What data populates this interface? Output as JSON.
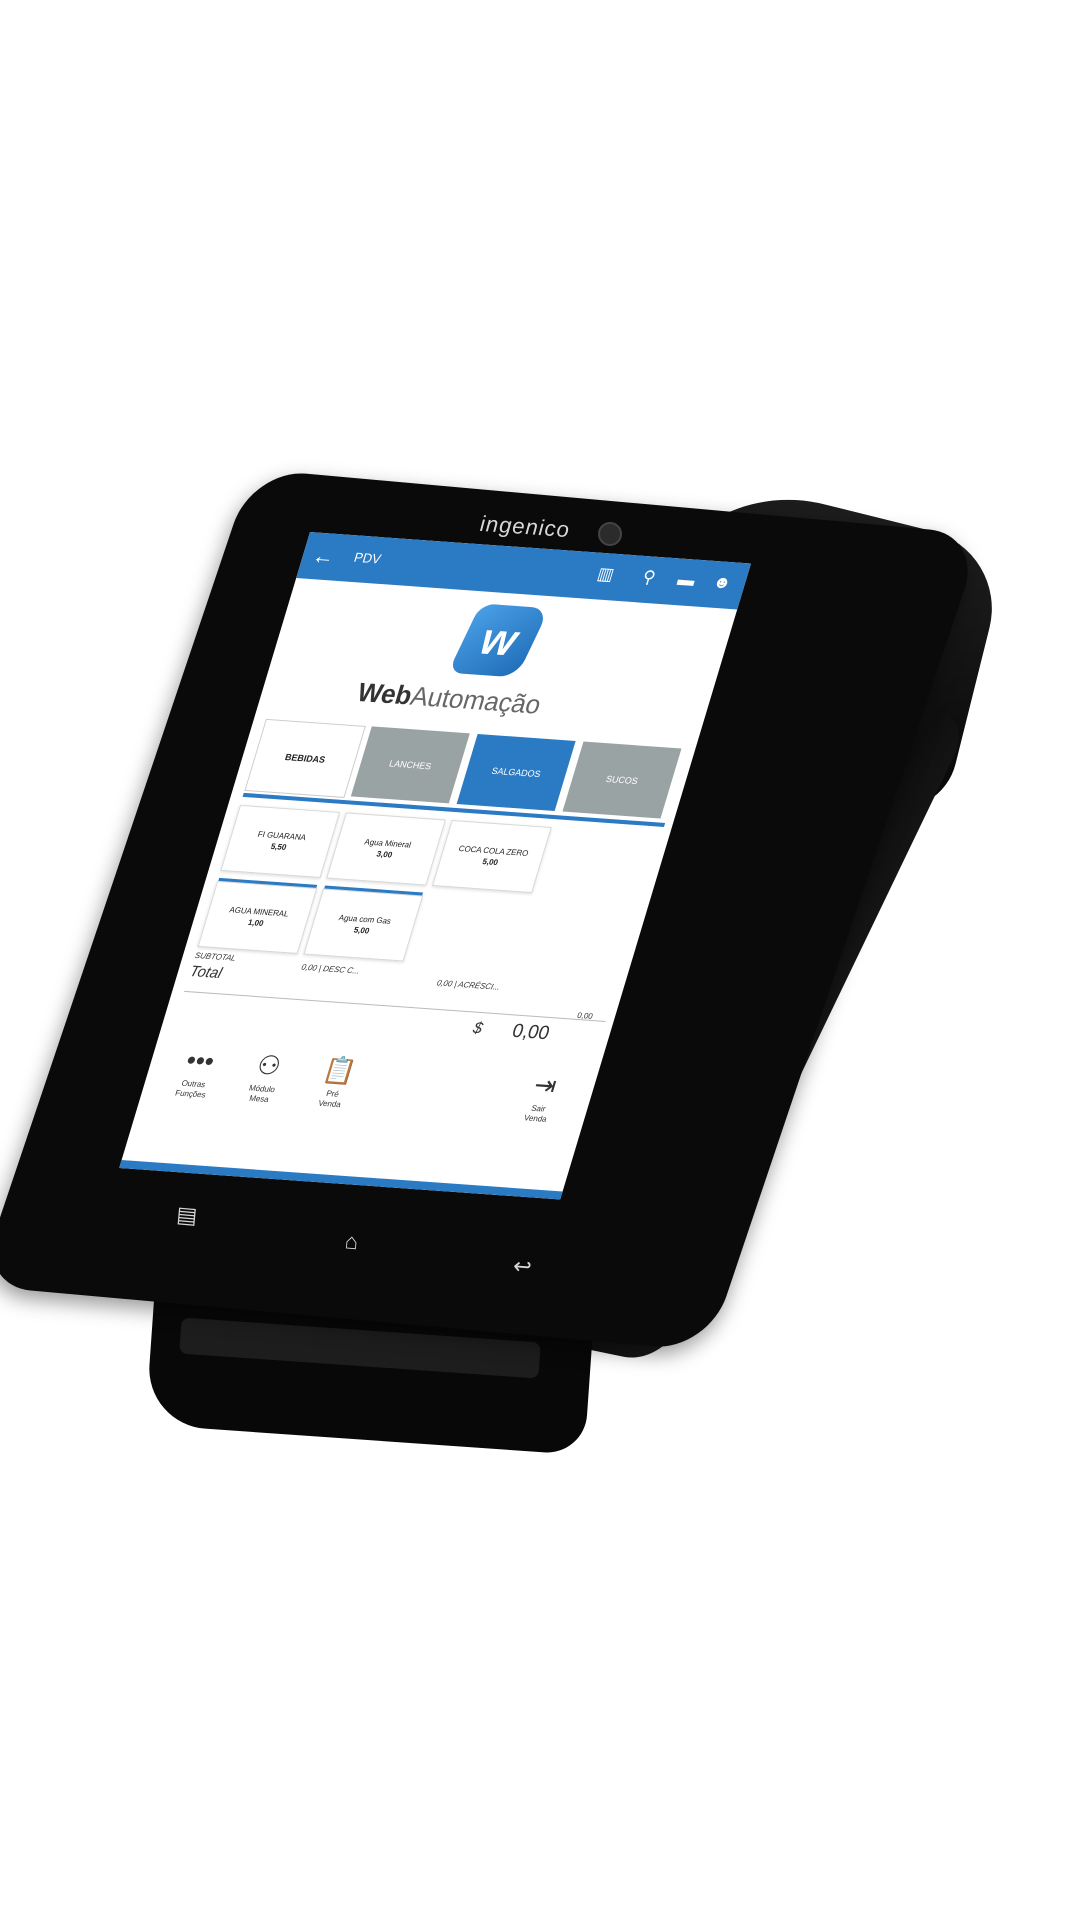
{
  "device": {
    "brand": "ingenico"
  },
  "toolbar": {
    "title": "PDV",
    "back_icon": "arrow-left-icon",
    "icons": [
      "barcode-icon",
      "search-icon",
      "printer-icon",
      "user-icon"
    ]
  },
  "logo": {
    "text_bold": "Web",
    "text_light": "Automação"
  },
  "categories": [
    "BEBIDAS",
    "LANCHES",
    "SALGADOS",
    "SUCOS"
  ],
  "products": [
    {
      "name": "FI GUARANA",
      "price": "5,50"
    },
    {
      "name": "Agua Mineral",
      "price": "3,00"
    },
    {
      "name": "COCA COLA ZERO",
      "price": "5,00"
    },
    {
      "name": "AGUA MINERAL",
      "price": "1,00"
    },
    {
      "name": "Agua com Gas",
      "price": "5,00"
    }
  ],
  "totals": {
    "subtotal_label": "SUBTOTAL",
    "desc": "0,00 | DESC C...",
    "acresc": "0,00 | ACRÉSCI...",
    "total_label": "Total",
    "small_value": "0,00",
    "currency": "$",
    "amount": "0,00"
  },
  "actions": [
    {
      "label1": "Outras",
      "label2": "Funções"
    },
    {
      "label1": "Módulo",
      "label2": "Mesa"
    },
    {
      "label1": "Pré",
      "label2": "Venda"
    },
    {
      "label1": "Sair",
      "label2": "Venda"
    }
  ],
  "colors": {
    "primary": "#2a7bc4",
    "category_gray": "#9aa3a3"
  }
}
